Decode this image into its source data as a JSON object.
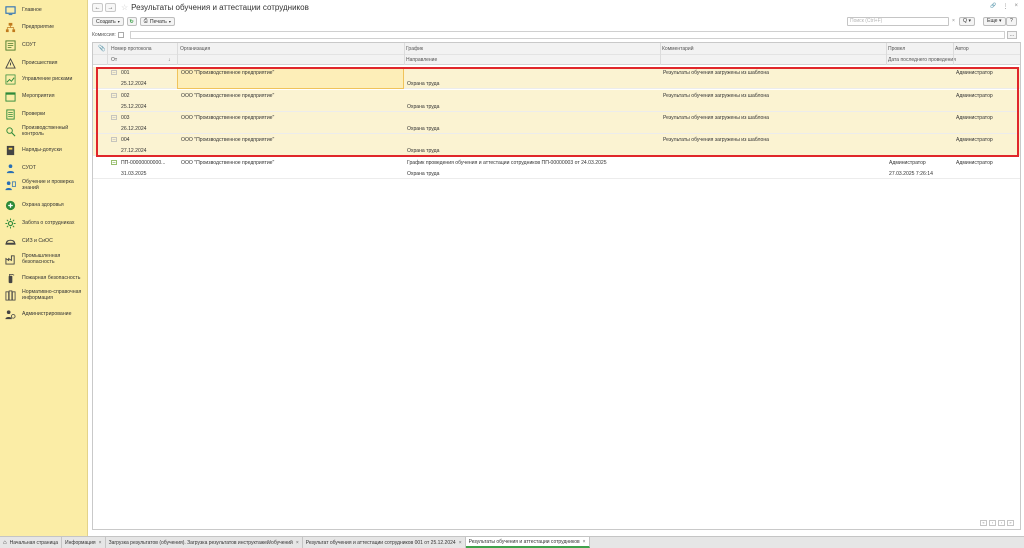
{
  "sidebar": {
    "items": [
      {
        "label": "Главное",
        "icon": "monitor-icon",
        "color": "#2a6fb5"
      },
      {
        "label": "Предприятие",
        "icon": "org-structure-icon",
        "color": "#c07a1d"
      },
      {
        "label": "СОУТ",
        "icon": "workplace-icon",
        "color": "#4a7a2a"
      },
      {
        "label": "Происшествия",
        "icon": "warning-icon",
        "color": "#444444"
      },
      {
        "label": "Управление рисками",
        "icon": "risk-chart-icon",
        "color": "#2e8a3a"
      },
      {
        "label": "Мероприятия",
        "icon": "calendar-icon",
        "color": "#2e8a3a"
      },
      {
        "label": "Проверки",
        "icon": "checklist-icon",
        "color": "#2e8a3a"
      },
      {
        "label": "Производственный контроль",
        "icon": "inspector-icon",
        "color": "#2e8a3a"
      },
      {
        "label": "Наряды-допуски",
        "icon": "permit-icon",
        "color": "#444444"
      },
      {
        "label": "СУОТ",
        "icon": "people-icon",
        "color": "#2a6fb5"
      },
      {
        "label": "Обучение и проверка знаний",
        "icon": "training-icon",
        "color": "#2a6fb5"
      },
      {
        "label": "Охрана здоровья",
        "icon": "health-icon",
        "color": "#2e8a3a"
      },
      {
        "label": "Забота о сотрудниках",
        "icon": "care-icon",
        "color": "#2e8a3a"
      },
      {
        "label": "СИЗ и СиОС",
        "icon": "ppe-icon",
        "color": "#444444"
      },
      {
        "label": "Промышленная безопасность",
        "icon": "industry-icon",
        "color": "#444444"
      },
      {
        "label": "Пожарная безопасность",
        "icon": "fire-extinguisher-icon",
        "color": "#444444"
      },
      {
        "label": "Нормативно-справочная информация",
        "icon": "books-icon",
        "color": "#444444"
      },
      {
        "label": "Администрирование",
        "icon": "admin-icon",
        "color": "#444444"
      }
    ]
  },
  "header": {
    "back": "←",
    "forward": "→",
    "title": "Результаты обучения и аттестации сотрудников",
    "link_icon": "🔗",
    "more": "⋮",
    "close": "×"
  },
  "toolbar": {
    "create_label": "Создать",
    "print_label": "Печать",
    "search_placeholder": "Поиск (Ctrl+F)",
    "search_clear": "×",
    "search_btn_label": "Q",
    "more_label": "Еще",
    "help_label": "?"
  },
  "filter": {
    "label": "Комиссия:",
    "btn": "..."
  },
  "table": {
    "headers": {
      "number": "Номер протокола",
      "date": "От",
      "org": "Организация",
      "schedule": "График",
      "direction": "Направление",
      "comment": "Комментарий",
      "conducted": "Провел",
      "last_date": "Дата последнего проведения",
      "author": "Автор",
      "sort_mark": "↓"
    },
    "rows": [
      {
        "number": "001",
        "date": "25.12.2024",
        "org": "ООО \"Производственное предприятие\"",
        "schedule": "",
        "direction": "Охрана труда",
        "comment": "Результаты обучения загружены из шаблона",
        "conducted": "",
        "last_date": "",
        "author": "Администратор"
      },
      {
        "number": "002",
        "date": "25.12.2024",
        "org": "ООО \"Производственное предприятие\"",
        "schedule": "",
        "direction": "Охрана труда",
        "comment": "Результаты обучения загружены из шаблона",
        "conducted": "",
        "last_date": "",
        "author": "Администратор"
      },
      {
        "number": "003",
        "date": "26.12.2024",
        "org": "ООО \"Производственное предприятие\"",
        "schedule": "",
        "direction": "Охрана труда",
        "comment": "Результаты обучения загружены из шаблона",
        "conducted": "",
        "last_date": "",
        "author": "Администратор"
      },
      {
        "number": "004",
        "date": "27.12.2024",
        "org": "ООО \"Производственное предприятие\"",
        "schedule": "",
        "direction": "Охрана труда",
        "comment": "Результаты обучения загружены из шаблона",
        "conducted": "",
        "last_date": "",
        "author": "Администратор"
      },
      {
        "number": "ПП-00000000000...",
        "date": "31.03.2025",
        "org": "ООО \"Производственное предприятие\"",
        "schedule": "График проведения обучения и аттестации сотрудников ПП-00000003 от 24.03.2025",
        "direction": "Охрана труда",
        "comment": "",
        "conducted": "Администратор",
        "last_date": "27.03.2025 7:26:14",
        "author": "Администратор"
      }
    ],
    "pager": [
      "«",
      "‹",
      "›",
      "»"
    ]
  },
  "tabs": [
    {
      "label": "Начальная страница",
      "home": true,
      "active": false
    },
    {
      "label": "Информация",
      "active": false
    },
    {
      "label": "Загрузка результатов (обучения). Загрузка результатов инструктажей/обучений",
      "active": false
    },
    {
      "label": "Результат обучения и аттестации сотрудников 001 от 25.12.2024",
      "active": false
    },
    {
      "label": "Результаты обучения и аттестации сотрудников",
      "active": true
    }
  ],
  "colors": {
    "sidebar_bg": "#fbeda6",
    "selected_row": "#fbf3d2",
    "highlight_frame": "#e0262a",
    "active_tab": "#3fa24b"
  }
}
